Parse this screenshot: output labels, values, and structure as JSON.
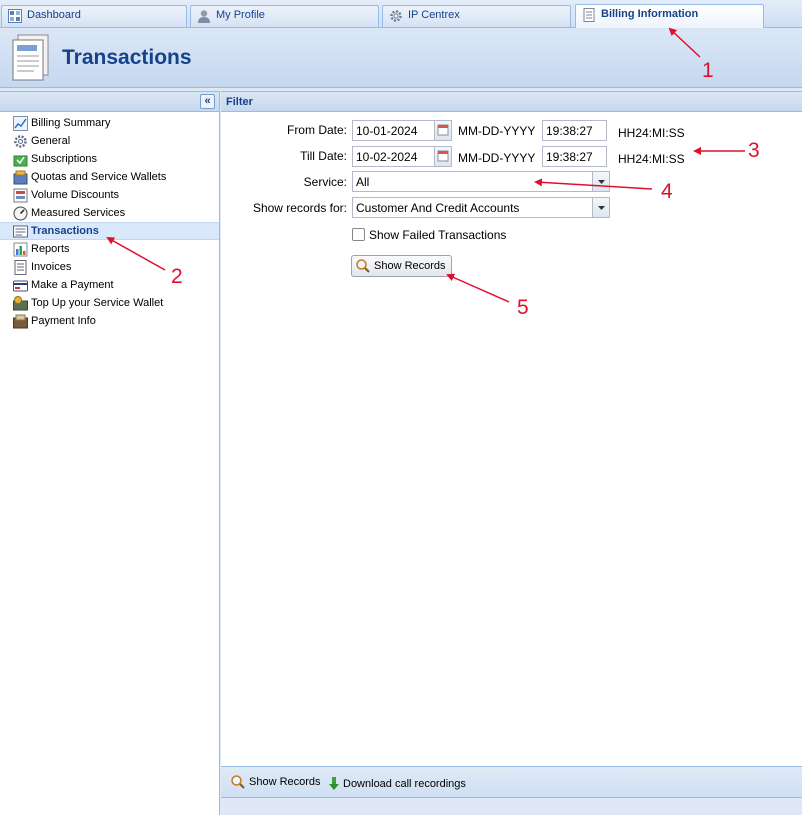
{
  "tabs": [
    {
      "label": "Dashboard",
      "icon": "dashboard-icon"
    },
    {
      "label": "My Profile",
      "icon": "user-icon"
    },
    {
      "label": "IP Centrex",
      "icon": "gear-icon"
    },
    {
      "label": "Billing Information",
      "icon": "document-icon",
      "active": true
    }
  ],
  "header": {
    "title": "Transactions"
  },
  "sidebar": {
    "items": [
      {
        "label": "Billing Summary",
        "icon": "chart-icon"
      },
      {
        "label": "General",
        "icon": "gear-icon"
      },
      {
        "label": "Subscriptions",
        "icon": "subscriptions-icon"
      },
      {
        "label": "Quotas and Service Wallets",
        "icon": "wallet-icon"
      },
      {
        "label": "Volume Discounts",
        "icon": "discount-icon"
      },
      {
        "label": "Measured Services",
        "icon": "gauge-icon"
      },
      {
        "label": "Transactions",
        "icon": "transactions-icon",
        "selected": true
      },
      {
        "label": "Reports",
        "icon": "bar-chart-icon"
      },
      {
        "label": "Invoices",
        "icon": "invoice-icon"
      },
      {
        "label": "Make a Payment",
        "icon": "credit-card-icon"
      },
      {
        "label": "Top Up your Service Wallet",
        "icon": "money-icon"
      },
      {
        "label": "Payment Info",
        "icon": "payment-info-icon"
      }
    ]
  },
  "filter": {
    "title": "Filter",
    "from_label": "From Date:",
    "from_date": "10-01-2024",
    "from_time": "19:38:27",
    "till_label": "Till Date:",
    "till_date": "10-02-2024",
    "till_time": "19:38:27",
    "date_format": "MM-DD-YYYY",
    "time_format": "HH24:MI:SS",
    "service_label": "Service:",
    "service_value": "All",
    "records_label": "Show records for:",
    "records_value": "Customer And Credit Accounts",
    "failed_label": "Show Failed Transactions",
    "show_button": "Show Records"
  },
  "toolbar": {
    "show_records": "Show Records",
    "download": "Download call recordings"
  },
  "annotations": [
    "1",
    "2",
    "3",
    "4",
    "5"
  ],
  "colors": {
    "accent": "#15428b",
    "annotation": "#e0102a",
    "border": "#99bbe8"
  }
}
